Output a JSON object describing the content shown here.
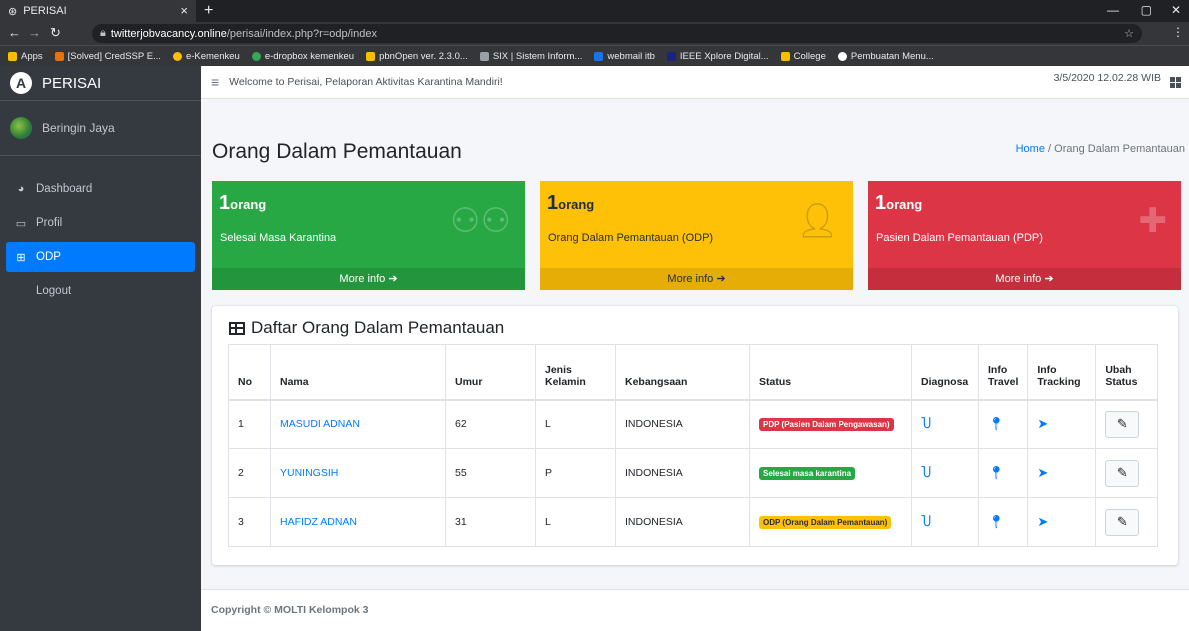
{
  "browser": {
    "tab_title": "PERISAI",
    "url_domain": "twitterjobvacancy.online",
    "url_path": "/perisai/index.php?r=odp/index",
    "bookmarks": [
      "Apps",
      "[Solved] CredSSP E...",
      "e-Kemenkeu",
      "e-dropbox kemenkeu",
      "pbnOpen ver. 2.3.0...",
      "SIX | Sistem Inform...",
      "webmail itb",
      "IEEE Xplore Digital...",
      "College",
      "Pembuatan Menu..."
    ]
  },
  "sidebar": {
    "brand": "PERISAI",
    "user": "Beringin Jaya",
    "items": [
      {
        "label": "Dashboard"
      },
      {
        "label": "Profil"
      },
      {
        "label": "ODP"
      },
      {
        "label": "Logout"
      }
    ]
  },
  "topbar": {
    "welcome": "Welcome to Perisai, Pelaporan Aktivitas Karantina Mandiri!",
    "datetime": "3/5/2020 12.02.28 WIB"
  },
  "page": {
    "title": "Orang Dalam Pemantauan",
    "breadcrumb_home": "Home",
    "breadcrumb_sep": "/",
    "breadcrumb_current": "Orang Dalam Pemantauan"
  },
  "boxes": [
    {
      "count": "1",
      "unit": "orang",
      "label": "Selesai Masa Karantina",
      "more": "More info",
      "color": "#28a745"
    },
    {
      "count": "1",
      "unit": "orang",
      "label": "Orang Dalam Pemantauan (ODP)",
      "more": "More info",
      "color": "#ffc107"
    },
    {
      "count": "1",
      "unit": "orang",
      "label": "Pasien Dalam Pemantauan (PDP)",
      "more": "More info",
      "color": "#dc3545"
    }
  ],
  "table": {
    "title": "Daftar Orang Dalam Pemantauan",
    "headers": [
      "No",
      "Nama",
      "Umur",
      "Jenis Kelamin",
      "Kebangsaan",
      "Status",
      "Diagnosa",
      "Info Travel",
      "Info Tracking",
      "Ubah Status"
    ],
    "rows": [
      {
        "no": "1",
        "nama": "MASUDI ADNAN",
        "umur": "62",
        "jk": "L",
        "bangsa": "INDONESIA",
        "status": "PDP (Pasien Dalam Pengawasan)",
        "status_color": "#dc3545"
      },
      {
        "no": "2",
        "nama": "YUNINGSIH",
        "umur": "55",
        "jk": "P",
        "bangsa": "INDONESIA",
        "status": "Selesai masa karantina",
        "status_color": "#28a745"
      },
      {
        "no": "3",
        "nama": "HAFIDZ ADNAN",
        "umur": "31",
        "jk": "L",
        "bangsa": "INDONESIA",
        "status": "ODP (Orang Dalam Pemantauan)",
        "status_color": "#ffc107"
      }
    ]
  },
  "footer": {
    "copyright": "Copyright © MOLTI Kelompok 3"
  }
}
